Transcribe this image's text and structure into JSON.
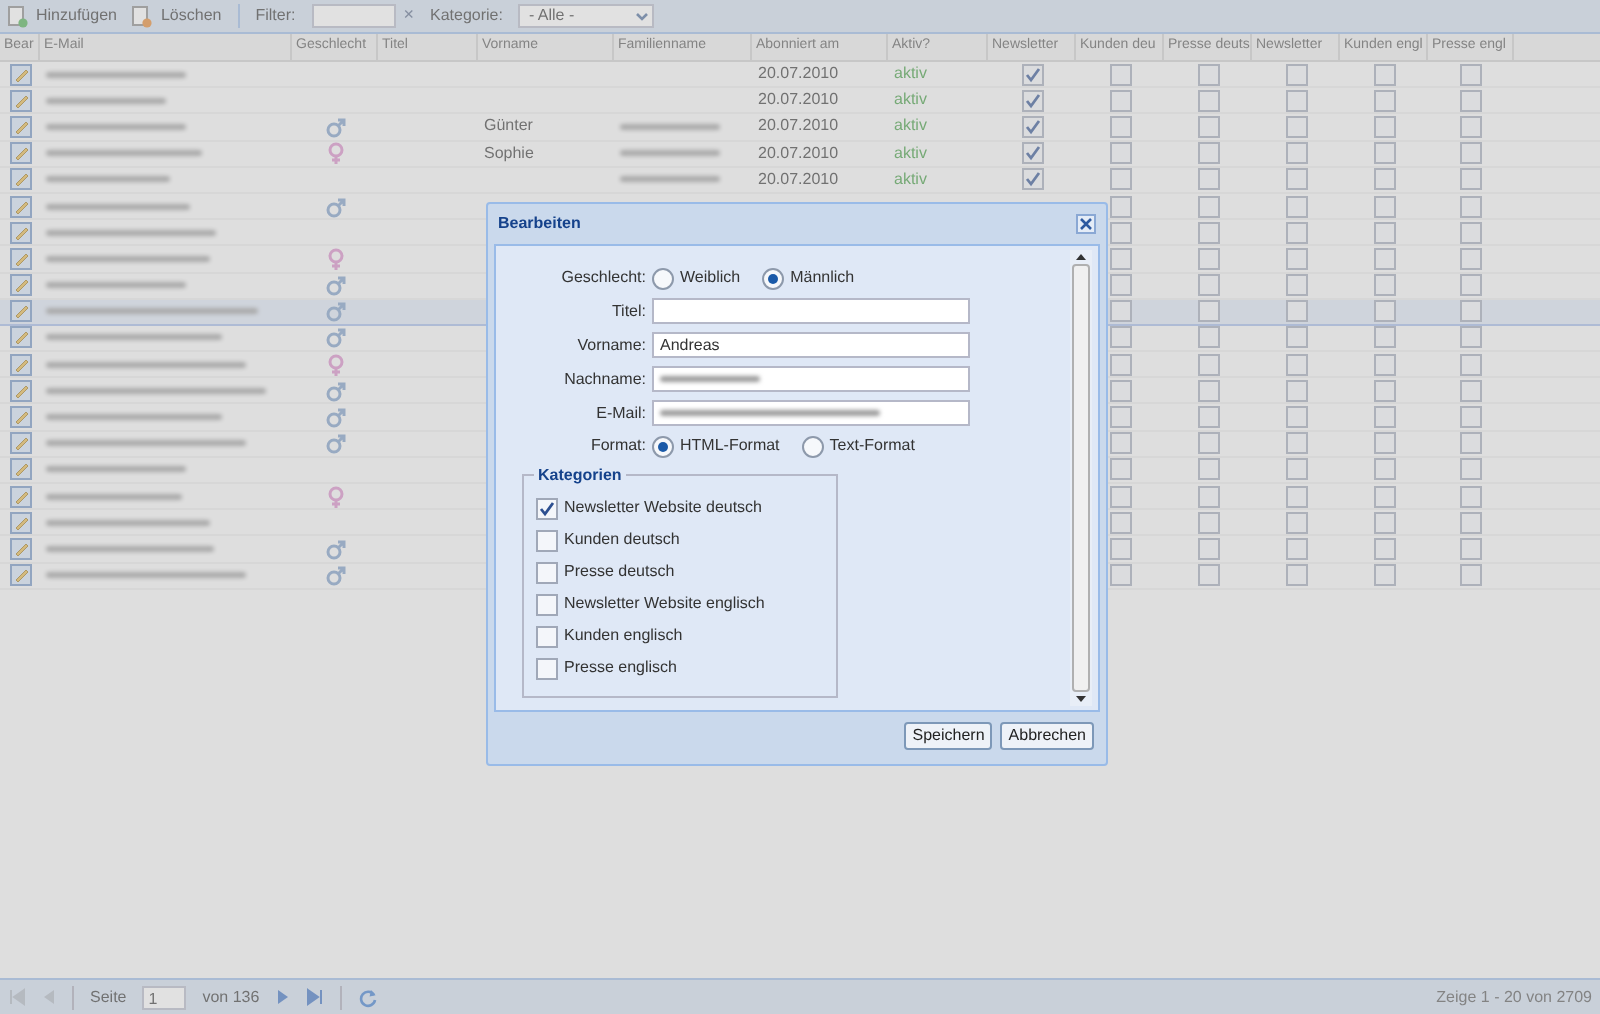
{
  "toolbar": {
    "add_button": "Hinzufügen",
    "delete_button": "Löschen",
    "filter_label": "Filter:",
    "clear_button": "×",
    "category_label": "Kategorie:",
    "category_value": "- Alle -"
  },
  "table": {
    "columns": [
      "Bear",
      "E-Mail",
      "Geschlecht",
      "Titel",
      "Vorname",
      "Familienname",
      "Abonniert am",
      "Aktiv?",
      "Newsletter",
      "Kunden deu",
      "Presse deuts",
      "Newsletter",
      "Kunden engl",
      "Presse engl"
    ],
    "rows": [
      {
        "selected": false,
        "kind": "none",
        "date": "20.07.2010",
        "status": "aktiv",
        "surname_redacted": false,
        "categories": [
          true,
          false,
          false,
          false,
          false,
          false
        ]
      },
      {
        "selected": false,
        "kind": "none",
        "date": "20.07.2010",
        "status": "aktiv",
        "surname_redacted": false,
        "categories": [
          true,
          false,
          false,
          false,
          false,
          false
        ]
      },
      {
        "selected": false,
        "kind": "male",
        "first_name": "Günter",
        "date": "20.07.2010",
        "status": "aktiv",
        "surname_redacted": true,
        "categories": [
          true,
          false,
          false,
          false,
          false,
          false
        ]
      },
      {
        "selected": false,
        "kind": "female",
        "first_name": "Sophie",
        "date": "20.07.2010",
        "status": "aktiv",
        "surname_redacted": true,
        "categories": [
          true,
          false,
          false,
          false,
          false,
          false
        ]
      },
      {
        "selected": false,
        "kind": "none",
        "date": "20.07.2010",
        "status": "aktiv",
        "surname_redacted": true,
        "categories": [
          true,
          false,
          false,
          false,
          false,
          false
        ]
      },
      {
        "selected": false,
        "kind": "male",
        "categories": [
          false,
          false,
          false,
          false,
          false
        ]
      },
      {
        "selected": false,
        "kind": "none",
        "categories": [
          false,
          false,
          false,
          false,
          false
        ]
      },
      {
        "selected": false,
        "kind": "female",
        "categories": [
          false,
          false,
          false,
          false,
          false
        ]
      },
      {
        "selected": false,
        "kind": "male",
        "categories": [
          false,
          false,
          false,
          false,
          false
        ]
      },
      {
        "selected": true,
        "kind": "male",
        "categories": [
          false,
          false,
          false,
          false,
          false
        ]
      },
      {
        "selected": false,
        "kind": "male",
        "categories": [
          false,
          false,
          false,
          false,
          false
        ]
      },
      {
        "selected": false,
        "kind": "female",
        "categories": [
          false,
          false,
          false,
          false,
          false
        ]
      },
      {
        "selected": false,
        "kind": "male",
        "categories": [
          false,
          false,
          false,
          false,
          false
        ]
      },
      {
        "selected": false,
        "kind": "male",
        "categories": [
          false,
          false,
          false,
          false,
          false
        ]
      },
      {
        "selected": false,
        "kind": "male",
        "categories": [
          false,
          false,
          false,
          false,
          false
        ]
      },
      {
        "selected": false,
        "kind": "none",
        "categories": [
          false,
          false,
          false,
          false,
          false
        ]
      },
      {
        "selected": false,
        "kind": "female",
        "categories": [
          false,
          false,
          false,
          false,
          false
        ]
      },
      {
        "selected": false,
        "kind": "none",
        "categories": [
          false,
          false,
          false,
          false,
          false
        ]
      },
      {
        "selected": false,
        "kind": "male",
        "categories": [
          false,
          false,
          false,
          false,
          false
        ]
      },
      {
        "selected": false,
        "kind": "male",
        "categories": [
          false,
          false,
          false,
          false,
          false
        ]
      }
    ]
  },
  "paging": {
    "page_label": "Seite",
    "page": "1",
    "of_label": "von 136",
    "summary": "Zeige 1 - 20 von 2709"
  },
  "dialog": {
    "title": "Bearbeiten",
    "gender": {
      "label": "Geschlecht:",
      "options": [
        {
          "label": "Weiblich",
          "selected": false
        },
        {
          "label": "Männlich",
          "selected": true
        }
      ]
    },
    "fields": [
      {
        "label": "Titel:",
        "redacted": false
      },
      {
        "label": "Vorname:",
        "value": "Andreas",
        "redacted": false
      },
      {
        "label": "Nachname:",
        "redacted": true
      },
      {
        "label": "E-Mail:",
        "redacted": true
      }
    ],
    "format": {
      "label": "Format:",
      "options": [
        {
          "label": "HTML-Format",
          "selected": true
        },
        {
          "label": "Text-Format",
          "selected": false
        }
      ]
    },
    "categories": {
      "title": "Kategorien",
      "items": [
        {
          "label": "Newsletter Website deutsch",
          "checked": true
        },
        {
          "label": "Kunden deutsch",
          "checked": false
        },
        {
          "label": "Presse deutsch",
          "checked": false
        },
        {
          "label": "Newsletter Website englisch",
          "checked": false
        },
        {
          "label": "Kunden englisch",
          "checked": false
        },
        {
          "label": "Presse englisch",
          "checked": false
        }
      ]
    },
    "buttons": [
      "Speichern",
      "Abbrechen"
    ]
  }
}
